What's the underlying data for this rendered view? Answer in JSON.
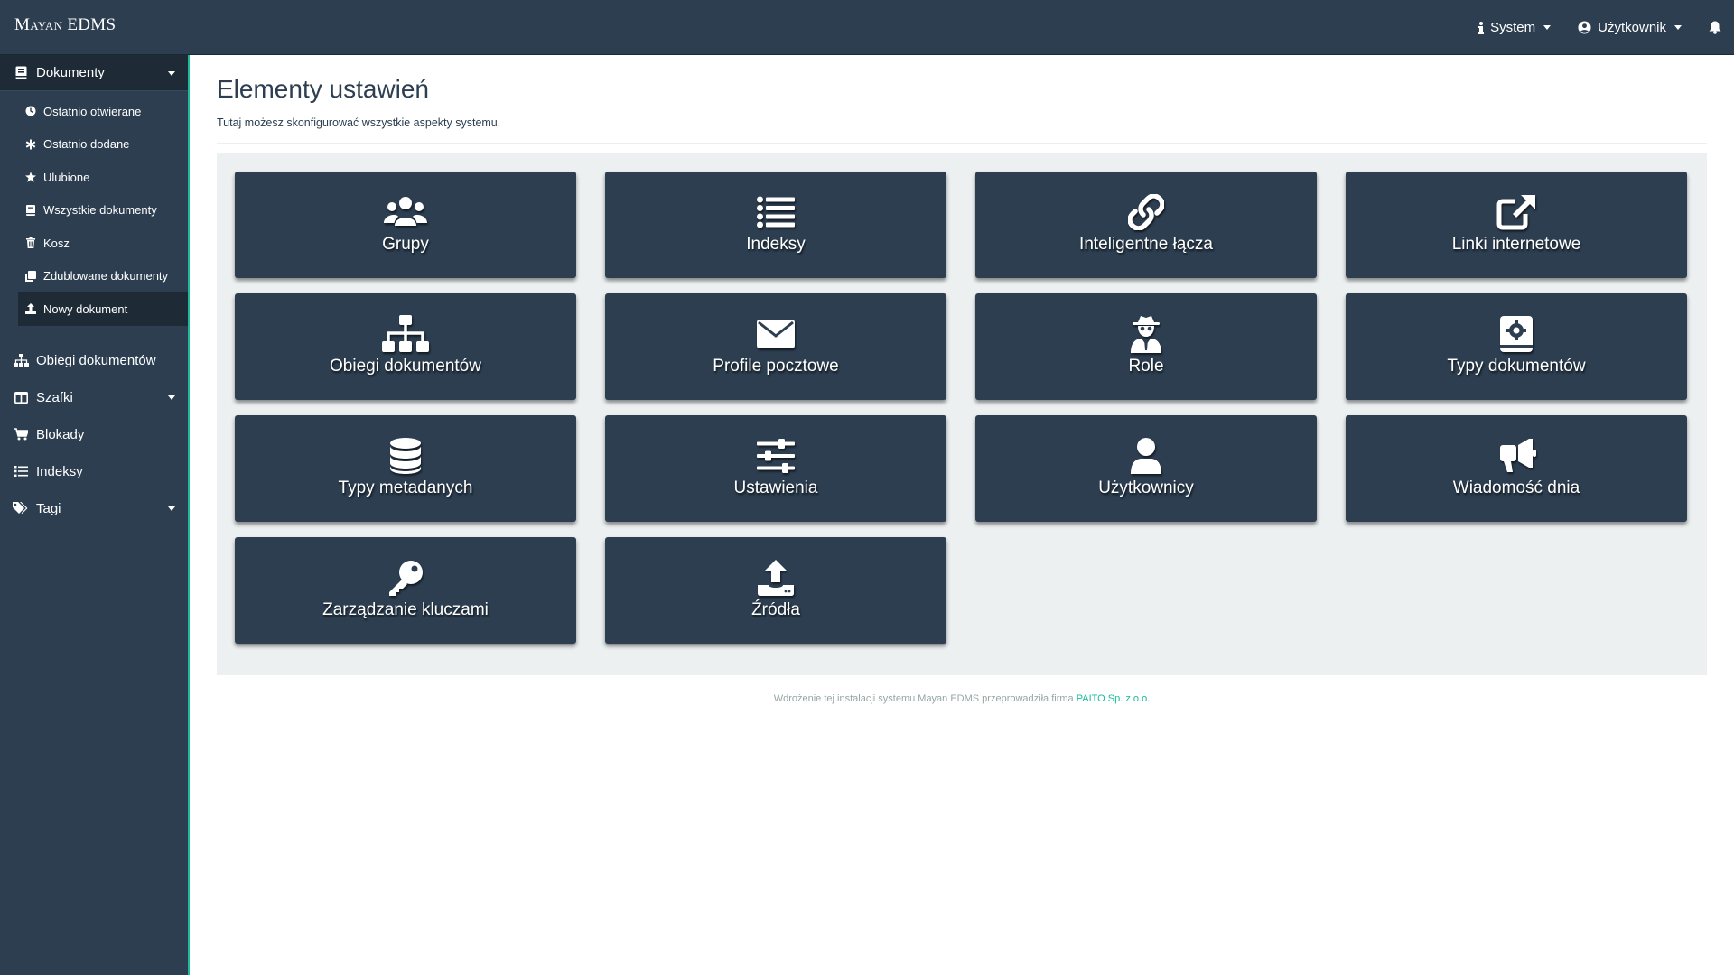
{
  "app": {
    "brand": "Mayan EDMS"
  },
  "navbar": {
    "system_label": "System",
    "user_label": "Użytkownik",
    "icons": [
      "info-icon",
      "user-circle-icon",
      "bell-icon"
    ]
  },
  "sidebar": {
    "documents": {
      "label": "Dokumenty",
      "items": [
        {
          "label": "Ostatnio otwierane",
          "icon": "clock-icon"
        },
        {
          "label": "Ostatnio dodane",
          "icon": "asterisk-icon"
        },
        {
          "label": "Ulubione",
          "icon": "star-icon"
        },
        {
          "label": "Wszystkie dokumenty",
          "icon": "book-icon"
        },
        {
          "label": "Kosz",
          "icon": "trash-icon"
        },
        {
          "label": "Zdublowane dokumenty",
          "icon": "clone-icon"
        },
        {
          "label": "Nowy dokument",
          "icon": "upload-icon"
        }
      ]
    },
    "sections": [
      {
        "label": "Obiegi dokumentów",
        "icon": "sitemap-icon"
      },
      {
        "label": "Szafki",
        "icon": "columns-icon"
      },
      {
        "label": "Blokady",
        "icon": "cart-icon"
      },
      {
        "label": "Indeksy",
        "icon": "list-icon"
      },
      {
        "label": "Tagi",
        "icon": "tags-icon"
      }
    ]
  },
  "main": {
    "title": "Elementy ustawień",
    "description": "Tutaj możesz skonfigurować wszystkie aspekty systemu.",
    "tiles": [
      {
        "label": "Grupy",
        "icon": "users-icon"
      },
      {
        "label": "Indeksy",
        "icon": "list-ul-icon"
      },
      {
        "label": "Inteligentne łącza",
        "icon": "link-icon"
      },
      {
        "label": "Linki internetowe",
        "icon": "external-link-icon"
      },
      {
        "label": "Obiegi dokumentów",
        "icon": "sitemap-icon"
      },
      {
        "label": "Profile pocztowe",
        "icon": "envelope-icon"
      },
      {
        "label": "Role",
        "icon": "user-secret-icon"
      },
      {
        "label": "Typy dokumentów",
        "icon": "book-cog-icon"
      },
      {
        "label": "Typy metadanych",
        "icon": "database-icon"
      },
      {
        "label": "Ustawienia",
        "icon": "sliders-icon"
      },
      {
        "label": "Użytkownicy",
        "icon": "user-icon"
      },
      {
        "label": "Wiadomość dnia",
        "icon": "bullhorn-icon"
      },
      {
        "label": "Zarządzanie kluczami",
        "icon": "key-icon"
      },
      {
        "label": "Źródła",
        "icon": "upload-tray-icon"
      }
    ]
  },
  "footer": {
    "text": "Wdrożenie tej instalacji systemu Mayan EDMS przeprowadziła firma",
    "link": "PAITO Sp. z o.o."
  }
}
